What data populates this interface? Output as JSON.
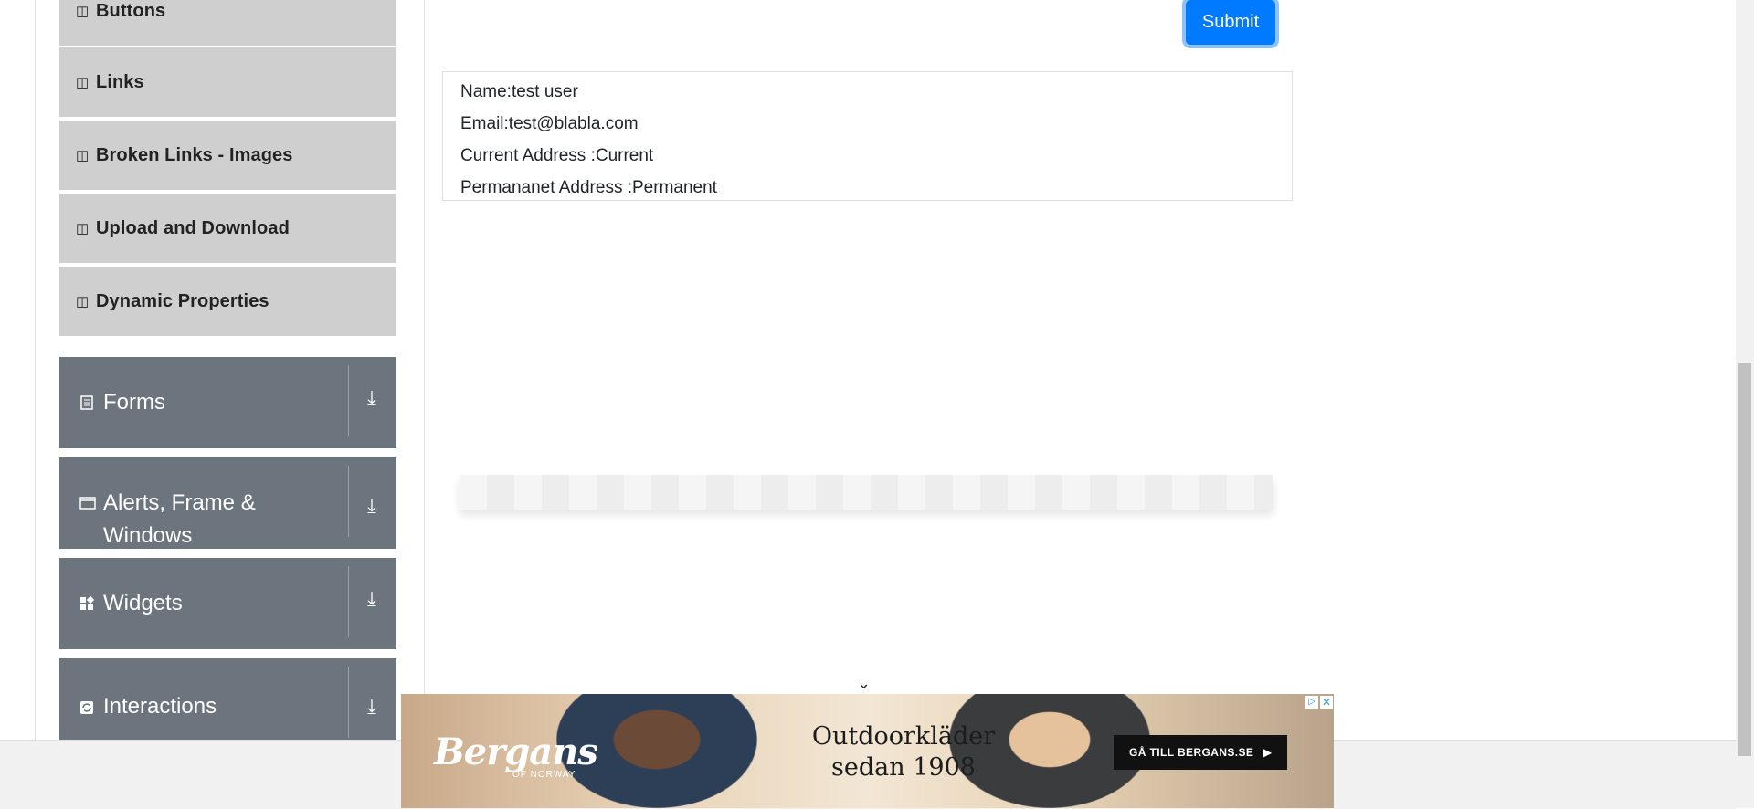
{
  "sidebar": {
    "elements_items": [
      {
        "label": "Buttons",
        "icon": "html5-icon"
      },
      {
        "label": "Links",
        "icon": "html5-icon"
      },
      {
        "label": "Broken Links - Images",
        "icon": "html5-icon"
      },
      {
        "label": "Upload and Download",
        "icon": "html5-icon"
      },
      {
        "label": "Dynamic Properties",
        "icon": "html5-icon"
      }
    ],
    "groups": [
      {
        "label": "Forms",
        "icon": "document-icon"
      },
      {
        "label": "Alerts, Frame & Windows",
        "icon": "window-icon"
      },
      {
        "label": "Widgets",
        "icon": "widgets-icon"
      },
      {
        "label": "Interactions",
        "icon": "refresh-icon"
      }
    ]
  },
  "form": {
    "submit_label": "Submit"
  },
  "output": {
    "name": "Name:test user",
    "email": "Email:test@blabla.com",
    "current_address": "Current Address :Current",
    "permanent_address": "Permananet Address :Permanent"
  },
  "ad": {
    "brand": "Bergans",
    "brand_sub": "OF NORWAY",
    "slogan_line1": "Outdoorkläder",
    "slogan_line2": "sedan 1908",
    "cta": "GÅ TILL BERGANS.SE"
  },
  "colors": {
    "primary": "#007bff",
    "sidebar_group": "#6c757d",
    "sidebar_item": "#cfcfcf"
  }
}
